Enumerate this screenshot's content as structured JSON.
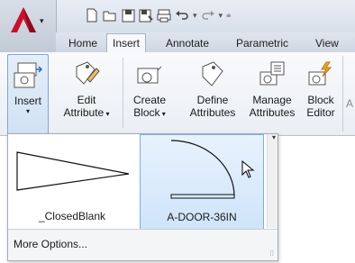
{
  "qat": {
    "icons": [
      "new-icon",
      "open-icon",
      "save-icon",
      "save-as-icon",
      "plot-icon",
      "undo-icon",
      "redo-icon"
    ]
  },
  "tabs": [
    {
      "label": "Home",
      "active": false
    },
    {
      "label": "Insert",
      "active": true
    },
    {
      "label": "Annotate",
      "active": false
    },
    {
      "label": "Parametric",
      "active": false
    },
    {
      "label": "View",
      "active": false
    }
  ],
  "ribbon": {
    "insert": {
      "label": "Insert"
    },
    "edit_attribute": {
      "line1": "Edit",
      "line2": "Attribute"
    },
    "create_block": {
      "line1": "Create",
      "line2": "Block"
    },
    "define_attributes": {
      "line1": "Define",
      "line2": "Attributes"
    },
    "manage_attributes": {
      "line1": "Manage",
      "line2": "Attributes"
    },
    "block_editor": {
      "line1": "Block",
      "line2": "Editor"
    },
    "cut_label": "A"
  },
  "gallery": {
    "blocks": [
      {
        "name": "_ClosedBlank",
        "selected": false
      },
      {
        "name": "A-DOOR-36IN",
        "selected": true
      }
    ],
    "more_options": "More Options..."
  },
  "colors": {
    "accent": "#c8102e",
    "selection": "#cfe4fa",
    "selection_border": "#7aaee0"
  }
}
